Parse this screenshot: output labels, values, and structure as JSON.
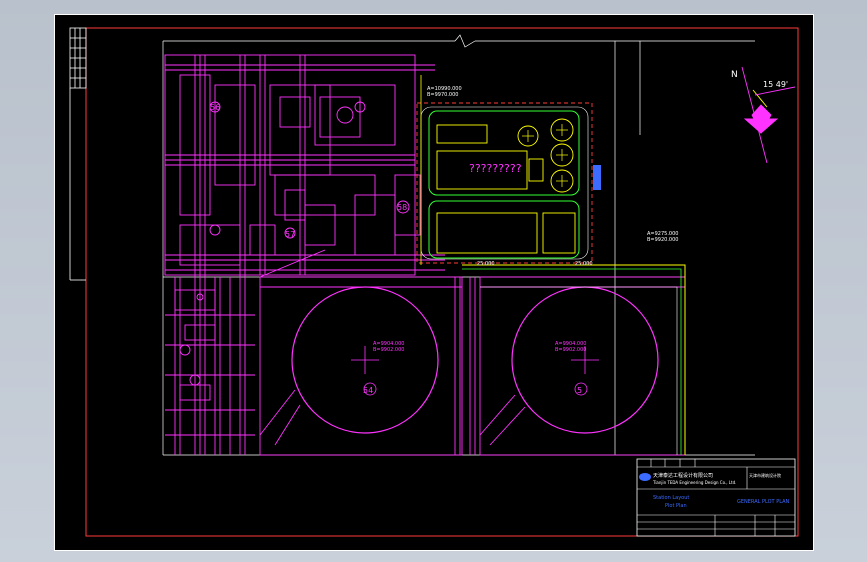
{
  "drawing": {
    "center_label": "?????????",
    "north_angle": "15 49'",
    "north_symbol": "N",
    "colors": {
      "background": "#000000",
      "border": "#ff3b3b",
      "plant_lines": "#ff33ff",
      "green_lines": "#33ff33",
      "yellow_lines": "#ffff00",
      "white_lines": "#ffffff",
      "title_blue": "#3b6bff"
    },
    "tank_labels": [
      "54",
      "5"
    ],
    "building_labels": [
      "58",
      "57",
      "56"
    ],
    "dim_labels": {
      "top_a": "A=10990.000",
      "top_b": "B=9970.000",
      "right_a": "A=9275.000",
      "right_b": "B=9920.000",
      "road_1": "25.000",
      "road_2": "25.000",
      "tank1_a": "A=9904.000",
      "tank1_b": "B=9902.000",
      "tank2_a": "A=9904.000",
      "tank2_b": "B=9902.000"
    }
  },
  "title_block": {
    "company_cn": "天津泰达工程设计有限公司",
    "company_en": "Tianjin TEDA Engineering Design Co., Ltd.",
    "stamp_text": "天津市建筑设计院",
    "project_line1": "Station Layout",
    "project_line2": "Plot Plan",
    "drawing_title": "GENERAL PLOT PLAN"
  }
}
